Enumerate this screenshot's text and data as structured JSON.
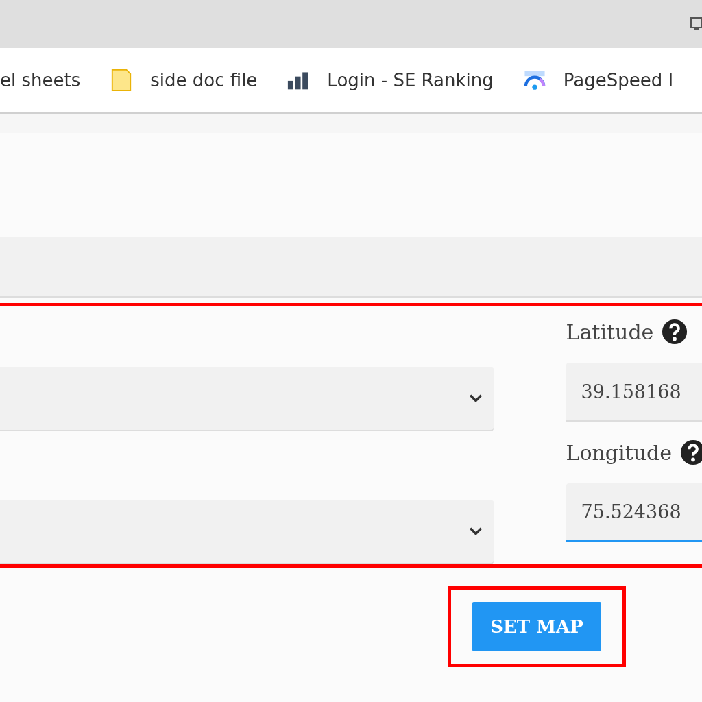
{
  "bookmarks": [
    {
      "label": "el sheets",
      "kind": "none"
    },
    {
      "label": "side doc file",
      "kind": "doc"
    },
    {
      "label": "Login - SE Ranking",
      "kind": "bars"
    },
    {
      "label": "PageSpeed I",
      "kind": "gauge"
    }
  ],
  "location_form": {
    "selects": [
      {
        "kind": "select"
      },
      {
        "kind": "select"
      }
    ],
    "fields": [
      {
        "label": "Latitude",
        "value": "39.158168",
        "focused": false
      },
      {
        "label": "Longitude",
        "value": "75.524368",
        "focused": true
      }
    ]
  },
  "set_map_button": "SET MAP"
}
